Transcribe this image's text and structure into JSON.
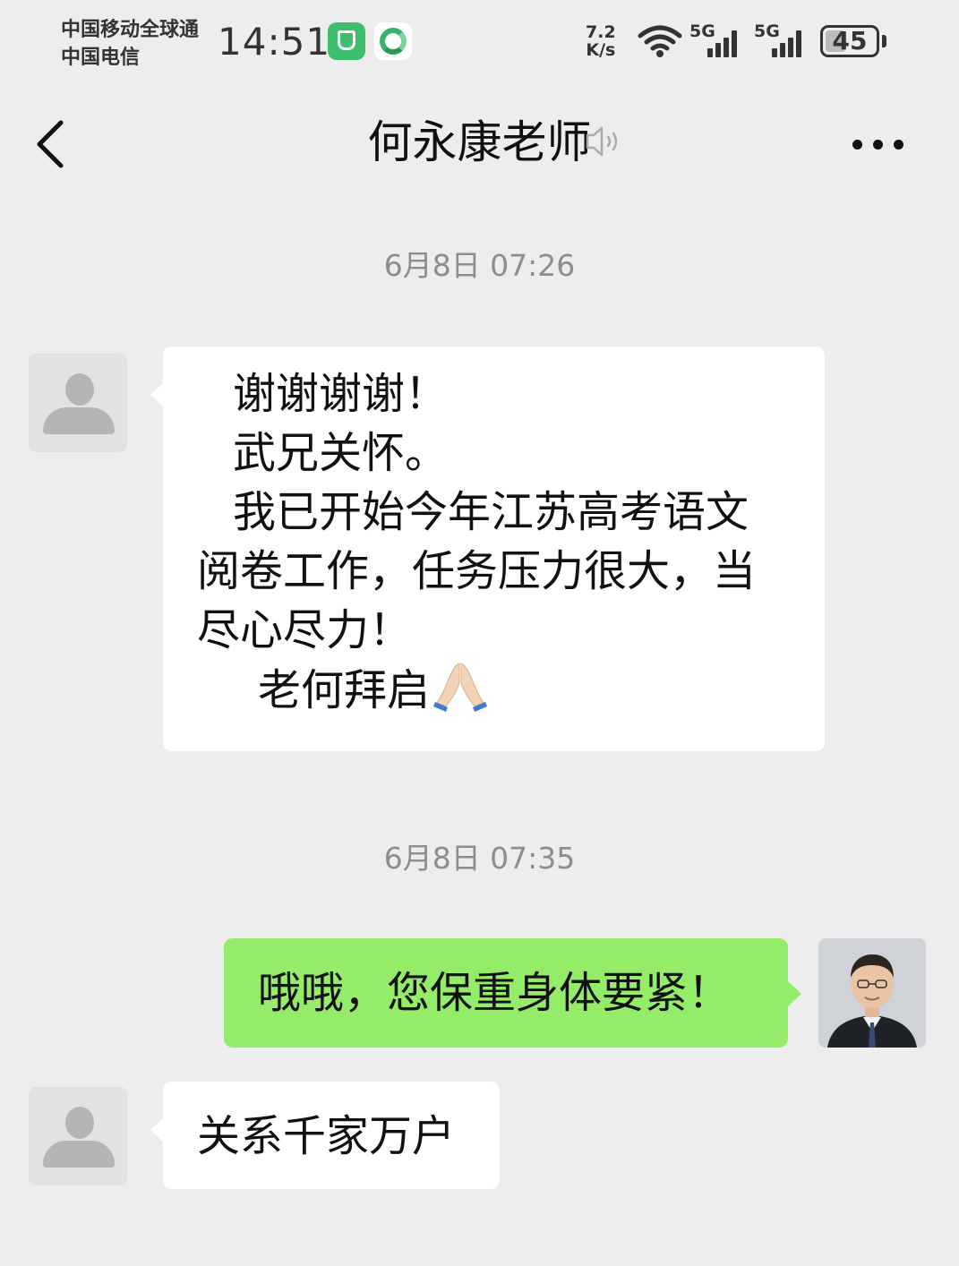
{
  "status_bar": {
    "carrier_1": "中国移动全球通",
    "carrier_2": "中国电信",
    "time": "14:51",
    "net_speed_value": "7.2",
    "net_speed_unit": "K/s",
    "sim1_label": "5G",
    "sim2_label": "5G",
    "battery": "45",
    "app_icons": [
      "mi-home-icon",
      "green-swirl-app-icon"
    ]
  },
  "nav": {
    "title": "何永康老师",
    "back_icon": "chevron-left-icon",
    "mute_icon": "muted-speaker-icon",
    "more_icon": "ellipsis-icon"
  },
  "messages": [
    {
      "timestamp": "6月8日 07:26",
      "sender": "contact",
      "lines": [
        "谢谢谢谢！",
        "武兄关怀。",
        "我已开始今年江苏高考语文",
        "阅卷工作，任务压力很大，当",
        "尽心尽力！",
        "老何拜启"
      ],
      "emoji": "🙏"
    },
    {
      "timestamp": "6月8日 07:35",
      "sender": "self",
      "text": "哦哦，您保重身体要紧！"
    },
    {
      "sender": "contact",
      "text": "关系千家万户"
    }
  ],
  "colors": {
    "background": "#ededed",
    "incoming_bubble": "#ffffff",
    "outgoing_bubble": "#95ec69",
    "timestamp": "#8d8d8d"
  }
}
